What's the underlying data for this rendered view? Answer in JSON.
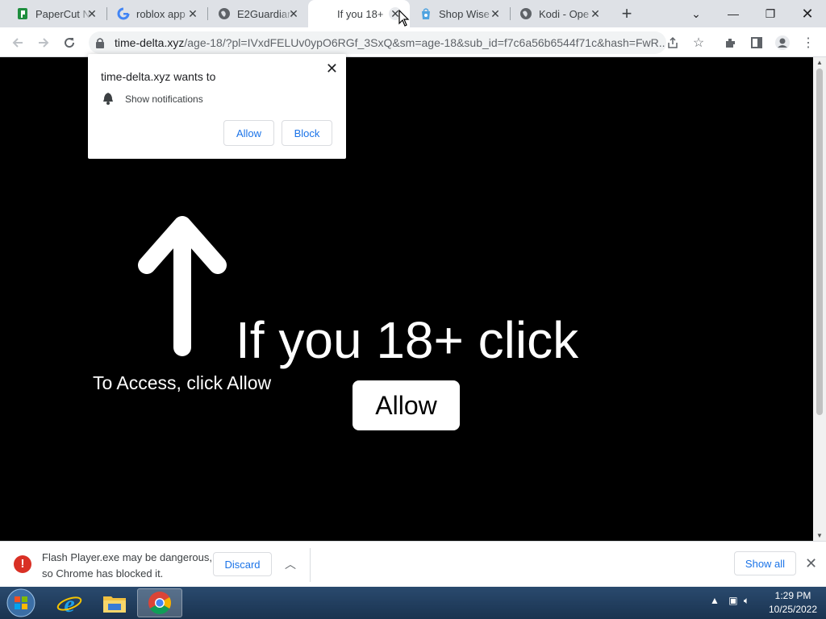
{
  "browser": {
    "tabs": [
      {
        "title": "PaperCut N",
        "icon": "papercut-icon"
      },
      {
        "title": "roblox app",
        "icon": "google-icon"
      },
      {
        "title": "E2Guardian",
        "icon": "globe-icon"
      },
      {
        "title": "If you 18+",
        "icon": "none",
        "active": true
      },
      {
        "title": "Shop Wise",
        "icon": "shopwise-icon"
      },
      {
        "title": "Kodi - Ope",
        "icon": "globe-icon"
      }
    ],
    "url_host": "time-delta.xyz",
    "url_path": "/age-18/?pl=IVxdFELUv0ypO6RGf_3SxQ&sm=age-18&sub_id=f7c6a56b6544f71c&hash=FwR..."
  },
  "permission_popup": {
    "title": "time-delta.xyz wants to",
    "permission": "Show notifications",
    "allow_label": "Allow",
    "block_label": "Block"
  },
  "page": {
    "headline": "If you 18+ click",
    "access_text": "To Access, click Allow",
    "allow_label": "Allow"
  },
  "download_shelf": {
    "warning_line1": "Flash Player.exe may be dangerous,",
    "warning_line2": "so Chrome has blocked it.",
    "discard_label": "Discard",
    "show_all_label": "Show all"
  },
  "taskbar": {
    "time": "1:29 PM",
    "date": "10/25/2022"
  },
  "colors": {
    "tabstrip": "#dee1e6",
    "accent_blue": "#1a73e8",
    "error_red": "#d93025",
    "page_bg": "#000000"
  }
}
